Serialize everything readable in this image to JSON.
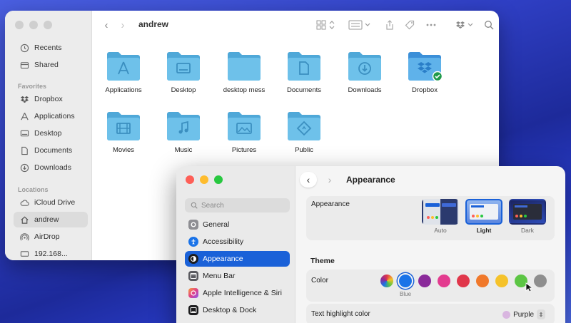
{
  "finder": {
    "title": "andrew",
    "sidebar": {
      "items_top": [
        {
          "label": "Recents",
          "icon": "clock-icon"
        },
        {
          "label": "Shared",
          "icon": "shared-icon"
        }
      ],
      "favorites_header": "Favorites",
      "favorites": [
        {
          "label": "Dropbox",
          "icon": "dropbox-icon"
        },
        {
          "label": "Applications",
          "icon": "applications-icon"
        },
        {
          "label": "Desktop",
          "icon": "desktop-icon"
        },
        {
          "label": "Documents",
          "icon": "document-icon"
        },
        {
          "label": "Downloads",
          "icon": "download-icon"
        }
      ],
      "locations_header": "Locations",
      "locations": [
        {
          "label": "iCloud Drive",
          "icon": "cloud-icon"
        },
        {
          "label": "andrew",
          "icon": "home-icon"
        },
        {
          "label": "AirDrop",
          "icon": "airdrop-icon"
        },
        {
          "label": "192.168...",
          "icon": "network-icon"
        }
      ]
    },
    "folders": [
      {
        "label": "Applications",
        "glyph": "A"
      },
      {
        "label": "Desktop",
        "glyph": "desktop"
      },
      {
        "label": "desktop mess",
        "glyph": ""
      },
      {
        "label": "Documents",
        "glyph": "doc"
      },
      {
        "label": "Downloads",
        "glyph": "down"
      },
      {
        "label": "Dropbox",
        "glyph": "dropbox"
      },
      {
        "label": "Movies",
        "glyph": "film"
      },
      {
        "label": "Music",
        "glyph": "note"
      },
      {
        "label": "Pictures",
        "glyph": "photo"
      },
      {
        "label": "Public",
        "glyph": "public"
      }
    ]
  },
  "settings": {
    "title": "Appearance",
    "search_placeholder": "Search",
    "sidebar_items": [
      {
        "label": "General",
        "color": "#8e8e93"
      },
      {
        "label": "Accessibility",
        "color": "#1a73e8"
      },
      {
        "label": "Appearance",
        "color": "#1c1c1e",
        "active": true
      },
      {
        "label": "Menu Bar",
        "color": "#5a5a5f"
      },
      {
        "label": "Apple Intelligence & Siri",
        "color": "#e05a8a"
      },
      {
        "label": "Desktop & Dock",
        "color": "#1c1c1e"
      }
    ],
    "appearance_label": "Appearance",
    "theme_options": [
      {
        "label": "Auto",
        "selected": false
      },
      {
        "label": "Light",
        "selected": true
      },
      {
        "label": "Dark",
        "selected": false
      }
    ],
    "theme_header": "Theme",
    "color_label": "Color",
    "accent_colors": [
      "multicolor",
      "#1a73e8",
      "#8a2a9a",
      "#e33b8f",
      "#e0364a",
      "#f0782a",
      "#f5c22a",
      "#5cc544",
      "#8e8e8e"
    ],
    "selected_color_name": "Blue",
    "highlight_label": "Text highlight color",
    "highlight_value": "Purple"
  }
}
